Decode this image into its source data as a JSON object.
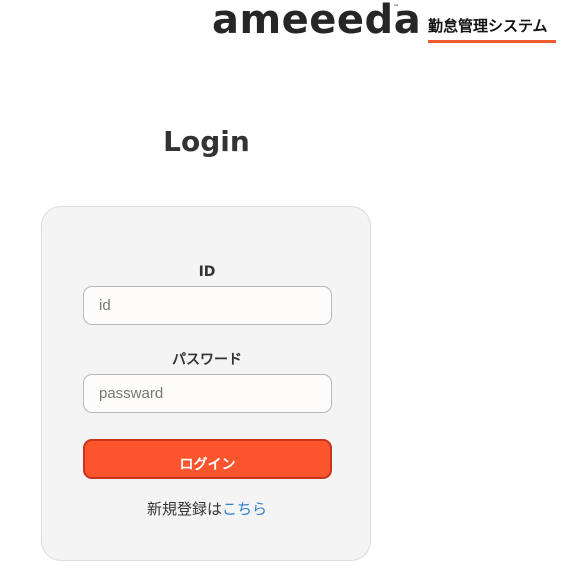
{
  "header": {
    "logo_text": "ameeeda",
    "logo_trademark": "™",
    "system_name": "勤怠管理システム",
    "accent_color": "#ef5a2e"
  },
  "login": {
    "title": "Login",
    "id_label": "ID",
    "id_placeholder": "id",
    "password_label": "パスワード",
    "password_placeholder": "passward",
    "submit_label": "ログイン",
    "button_color": "#fc542c",
    "register_text": "新規登録は",
    "register_link": "こちら",
    "link_color": "#2f80c9"
  }
}
